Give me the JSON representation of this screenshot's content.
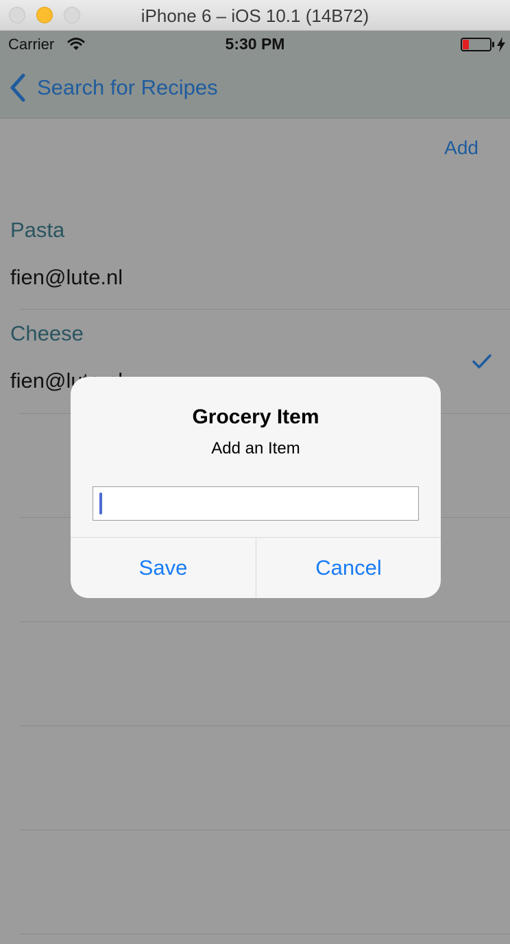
{
  "window": {
    "title": "iPhone 6 – iOS 10.1 (14B72)"
  },
  "status_bar": {
    "carrier": "Carrier",
    "time": "5:30 PM"
  },
  "nav": {
    "back_label": "Search for Recipes",
    "add_label": "Add"
  },
  "list": {
    "sections": [
      {
        "header": "Pasta",
        "item": "fien@lute.nl",
        "checked": false
      },
      {
        "header": "Cheese",
        "item": "fien@lute.nl",
        "checked": true
      }
    ]
  },
  "alert": {
    "title": "Grocery Item",
    "message": "Add an Item",
    "field_value": "",
    "save_label": "Save",
    "cancel_label": "Cancel"
  },
  "colors": {
    "tint": "#1f5c9e",
    "alert_button": "#1a7cf5",
    "battery_low": "#e02020"
  },
  "icons": [
    "wifi-icon",
    "battery-icon",
    "charging-bolt-icon",
    "back-chevron-icon",
    "checkmark-icon"
  ]
}
